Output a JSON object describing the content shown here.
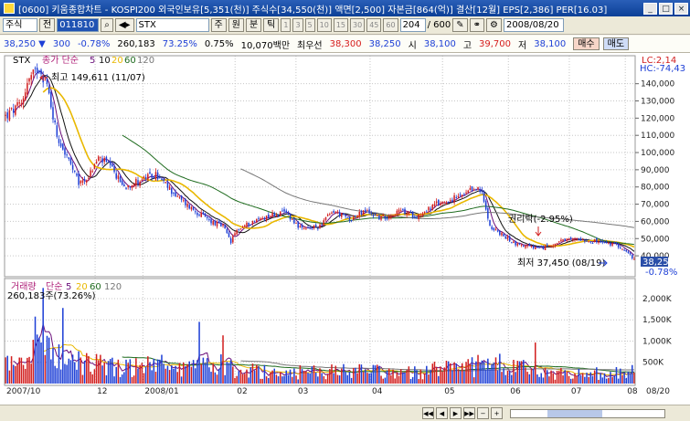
{
  "window": {
    "title": "[0600] 키움종합차트 - KOSPI200 외국인보유[5,351(천)] 주식수[34,550(천)] 액면[2,500] 자본금[864(억)] 결산[12월] EPS[2,386] PER[16.03]",
    "buttons": [
      "_",
      "□",
      "×"
    ]
  },
  "toolbar": {
    "market": "주식",
    "prefix": "전",
    "code": "011810",
    "name": "STX",
    "mode_label": "주",
    "period_labels": [
      "원",
      "분",
      "틱"
    ],
    "minute_labels": [
      "1",
      "3",
      "5",
      "10",
      "15",
      "30",
      "45",
      "60"
    ],
    "count": "204",
    "total": "/ 600",
    "date": "2008/08/20"
  },
  "quote": {
    "price": "38,250 ▼",
    "change": "300",
    "change_pct": "-0.78%",
    "volume": "260,183",
    "vol_ratio": "73.25%",
    "turnover": "0.75%",
    "amount": "10,070백만",
    "best_offer_label": "최우선",
    "best_ask": "38,300",
    "best_bid": "38,250",
    "open_label": "시",
    "open": "38,100",
    "high_label": "고",
    "high": "39,700",
    "low_label": "저",
    "low": "38,100",
    "buy": "매수",
    "sell": "매도"
  },
  "colors": {
    "up": "#d21f1f",
    "down": "#1d3fd6",
    "ma5": "#6b0e7a",
    "ma10": "#111111",
    "ma20": "#e9b800",
    "ma60": "#1e6b1e",
    "ma120": "#777777",
    "grid": "#c6c6c6"
  },
  "chart_data": {
    "type": "candlestick",
    "symbol": "STX",
    "price_legend": {
      "prefix": "STX",
      "label": "종가 단순",
      "periods": [
        "5",
        "10",
        "20",
        "60",
        "120"
      ]
    },
    "volume_legend": {
      "prefix": "거래량",
      "label": "단순",
      "periods": [
        "5",
        "20",
        "60",
        "120"
      ]
    },
    "price_ticks": [
      140000,
      130000,
      120000,
      110000,
      100000,
      90000,
      80000,
      70000,
      60000,
      50000,
      40000
    ],
    "price_tick_labels": [
      "140,000",
      "130,000",
      "120,000",
      "110,000",
      "100,000",
      "90,000",
      "80,000",
      "70,000",
      "60,000",
      "50,000",
      "40,000"
    ],
    "ylim": [
      30500,
      151500
    ],
    "volume_ticks": [
      2000000,
      1500000,
      1000000,
      500000
    ],
    "volume_tick_labels": [
      "2,000K",
      "1,500K",
      "1,000K",
      "500K"
    ],
    "volume_ylim": [
      0,
      2300000
    ],
    "x_labels": [
      "2007/10",
      "12",
      "2008/01",
      "02",
      "03",
      "04",
      "05",
      "06",
      "07",
      "08"
    ],
    "last_date_label": "08/20",
    "annotations": {
      "max": "최고 149,611 (11/07)",
      "min": "최저 37,450 (08/19)",
      "rights": "권리락(-2.95%)",
      "last_price": "38,250",
      "last_pct": "-0.78%",
      "lc": "LC:2,14",
      "hc": "HC:-74,43",
      "volume_summary": "260,183주(73.26%)"
    },
    "anchors": [
      [
        0,
        121000
      ],
      [
        8,
        128000
      ],
      [
        11,
        141000
      ],
      [
        17,
        149611
      ],
      [
        21,
        139000
      ],
      [
        26,
        110000
      ],
      [
        32,
        95000
      ],
      [
        37,
        82000
      ],
      [
        42,
        86000
      ],
      [
        47,
        97000
      ],
      [
        52,
        93000
      ],
      [
        60,
        80000
      ],
      [
        68,
        84000
      ],
      [
        76,
        87000
      ],
      [
        82,
        80000
      ],
      [
        88,
        73000
      ],
      [
        96,
        66000
      ],
      [
        104,
        60000
      ],
      [
        110,
        57000
      ],
      [
        114,
        48000
      ],
      [
        117,
        55000
      ],
      [
        125,
        60000
      ],
      [
        135,
        64000
      ],
      [
        142,
        65000
      ],
      [
        150,
        55000
      ],
      [
        158,
        57000
      ],
      [
        166,
        66000
      ],
      [
        174,
        61000
      ],
      [
        182,
        66000
      ],
      [
        190,
        62000
      ],
      [
        200,
        66000
      ],
      [
        208,
        63000
      ],
      [
        218,
        70000
      ],
      [
        226,
        73000
      ],
      [
        232,
        75000
      ],
      [
        238,
        80000
      ],
      [
        241,
        76000
      ],
      [
        244,
        62000
      ],
      [
        246,
        56000
      ],
      [
        258,
        47000
      ],
      [
        270,
        44000
      ],
      [
        280,
        48000
      ],
      [
        290,
        50000
      ],
      [
        300,
        48000
      ],
      [
        310,
        46000
      ],
      [
        318,
        38250
      ]
    ],
    "vol_anchors": [
      [
        0,
        500
      ],
      [
        10,
        480
      ],
      [
        17,
        1150
      ],
      [
        22,
        880
      ],
      [
        30,
        640
      ],
      [
        40,
        520
      ],
      [
        50,
        480
      ],
      [
        60,
        380
      ],
      [
        70,
        460
      ],
      [
        80,
        420
      ],
      [
        90,
        330
      ],
      [
        100,
        380
      ],
      [
        110,
        450
      ],
      [
        120,
        320
      ],
      [
        130,
        300
      ],
      [
        140,
        280
      ],
      [
        150,
        260
      ],
      [
        160,
        280
      ],
      [
        170,
        300
      ],
      [
        180,
        300
      ],
      [
        190,
        270
      ],
      [
        200,
        260
      ],
      [
        210,
        270
      ],
      [
        220,
        320
      ],
      [
        230,
        350
      ],
      [
        240,
        420
      ],
      [
        246,
        480
      ],
      [
        255,
        390
      ],
      [
        265,
        300
      ],
      [
        275,
        240
      ],
      [
        285,
        220
      ],
      [
        295,
        240
      ],
      [
        305,
        230
      ],
      [
        315,
        280
      ],
      [
        318,
        260
      ]
    ]
  }
}
